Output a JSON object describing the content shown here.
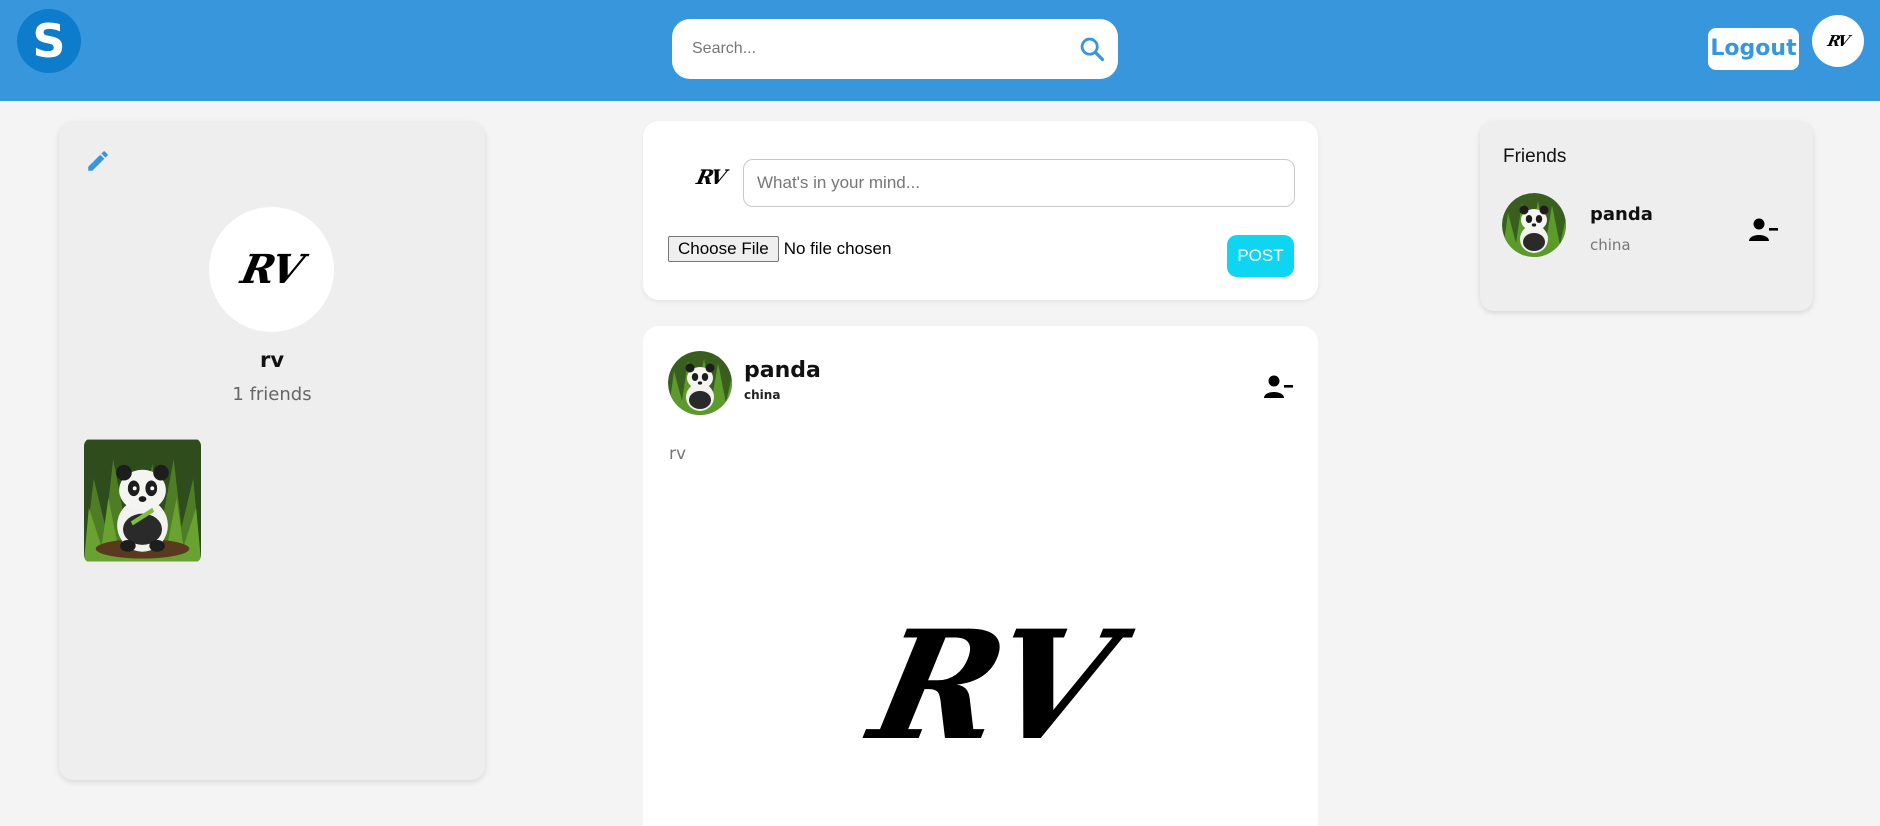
{
  "header": {
    "logo_letter": "S",
    "search_placeholder": "Search...",
    "logout_label": "Logout",
    "avatar_text": "RV"
  },
  "profile": {
    "avatar_text": "RV",
    "name": "rv",
    "friends_count_text": "1 friends"
  },
  "composer": {
    "avatar_text": "RV",
    "placeholder": "What's in your mind...",
    "file_button_label": "Choose File",
    "file_status": "No file chosen",
    "post_label": "POST"
  },
  "post": {
    "author_name": "panda",
    "author_location": "china",
    "text": "rv",
    "image_text": "RV"
  },
  "friends": {
    "title": "Friends",
    "items": [
      {
        "name": "panda",
        "location": "china"
      }
    ]
  },
  "colors": {
    "header_bg": "#3896dc",
    "logo_bg": "#0d7ccb",
    "post_button_bg": "#0fd6f0",
    "page_bg": "#f4f4f4",
    "card_bg": "#eeeeee"
  },
  "icons": {
    "search": "search-icon",
    "edit": "pencil-icon",
    "remove_friend": "person-remove-icon"
  }
}
